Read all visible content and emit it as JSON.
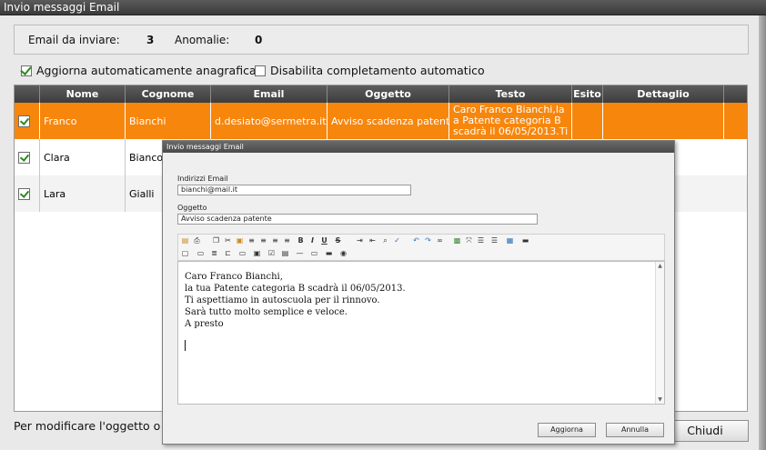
{
  "window": {
    "title": "Invio messaggi Email"
  },
  "summary": {
    "email_label": "Email da inviare:",
    "email_count": "3",
    "anomalie_label": "Anomalie:",
    "anomalie_count": "0"
  },
  "options": {
    "aggiorna": {
      "label": "Aggiorna automaticamente anagrafica",
      "checked": true
    },
    "disabilita": {
      "label": "Disabilita completamento automatico",
      "checked": false
    }
  },
  "grid": {
    "columns": [
      "Nome",
      "Cognome",
      "Email",
      "Oggetto",
      "Testo",
      "Esito",
      "Dettaglio"
    ],
    "rows": [
      {
        "checked": true,
        "nome": "Franco",
        "cognome": "Bianchi",
        "email": "d.desiato@sermetra.it",
        "oggetto": "Avviso scadenza patente",
        "testo": [
          "Caro Franco Bianchi,la",
          "a Patente categoria B",
          "scadrà il 06/05/2013.Ti"
        ],
        "esito": "",
        "dettaglio": ""
      },
      {
        "checked": true,
        "nome": "Clara",
        "cognome": "Bianco"
      },
      {
        "checked": true,
        "nome": "Lara",
        "cognome": "Gialli"
      }
    ]
  },
  "footer": {
    "text": "Per modificare l'oggetto o il",
    "close_label": "Chiudi"
  },
  "dialog": {
    "title": "Invio messaggi Email",
    "email_label": "Indirizzi Email",
    "email_value": "bianchi@mail.it",
    "subject_label": "Oggetto",
    "subject_value": "Avviso scadenza patente",
    "body": [
      "Caro Franco Bianchi,",
      "la tua Patente categoria B scadrà il 06/05/2013.",
      "Ti aspettiamo in autoscuola per il rinnovo.",
      "Sarà tutto molto semplice e veloce.",
      "A presto"
    ],
    "update_label": "Aggiorna",
    "cancel_label": "Annulla"
  },
  "colors": {
    "selected_row": "#f7860d",
    "header": "#4a4a4a",
    "arrow": "#e02020",
    "check": "#2d8a1e"
  }
}
